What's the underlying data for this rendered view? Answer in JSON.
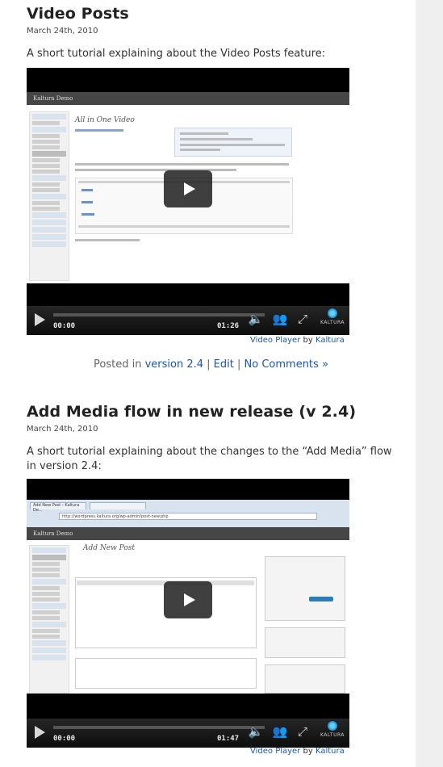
{
  "posts": [
    {
      "title": "Video Posts",
      "date": "March 24th, 2010",
      "description": "A short tutorial explaining about the Video Posts feature:",
      "player": {
        "elapsed": "00:00",
        "duration": "01:26",
        "brand": "KALTURA",
        "screenshot": {
          "app_title": "Kaltura Demo",
          "page_title": "All in One Video",
          "table_rows": [
            "Black",
            "White",
            "Yellow"
          ]
        }
      },
      "credit": {
        "player_link": "Video Player",
        "by": "by",
        "author_link": "Kaltura"
      },
      "meta": {
        "posted_in": "Posted in",
        "category": "version 2.4",
        "sep1": "|",
        "edit": "Edit",
        "sep2": "|",
        "comments": "No Comments »"
      }
    },
    {
      "title": "Add Media flow in new release (v 2.4)",
      "date": "March 24th, 2010",
      "description": "A short tutorial explaining about the changes to the “Add Media” flow in version 2.4:",
      "player": {
        "elapsed": "00:00",
        "duration": "01:47",
        "brand": "KALTURA",
        "screenshot": {
          "app_title": "Kaltura Demo",
          "page_title": "Add New Post",
          "tab_label": "Add New Post ‹ Kaltura De...",
          "url": "http://wordpress.kaltura.org/wp-admin/post-new.php"
        }
      },
      "credit": {
        "player_link": "Video Player",
        "by": "by",
        "author_link": "Kaltura"
      }
    }
  ]
}
